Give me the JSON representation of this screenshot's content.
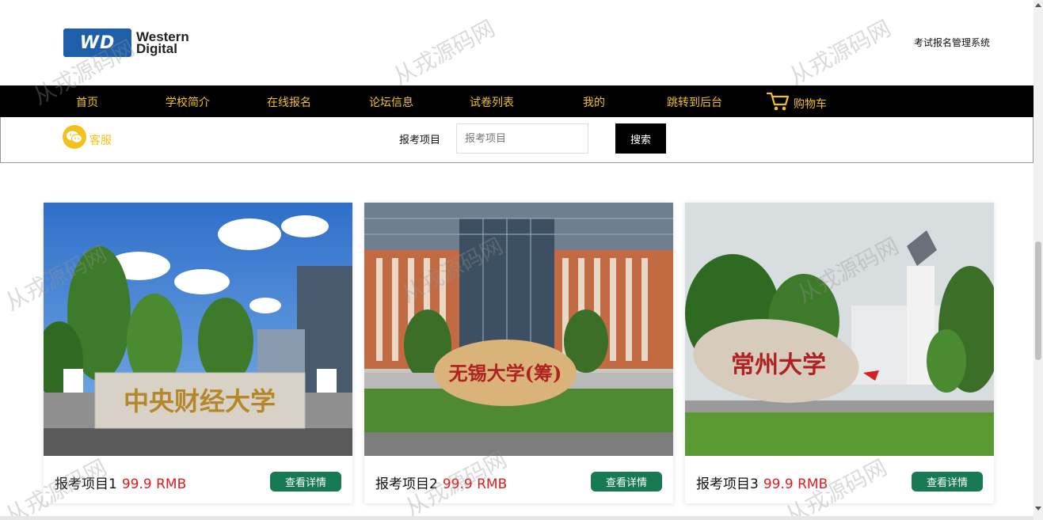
{
  "header": {
    "logo_text": [
      "Western",
      "Digital"
    ],
    "logo_mark": "WD",
    "system_title": "考试报名管理系统"
  },
  "nav": {
    "items": [
      {
        "label": "首页"
      },
      {
        "label": "学校简介"
      },
      {
        "label": "在线报名"
      },
      {
        "label": "论坛信息"
      },
      {
        "label": "试卷列表"
      },
      {
        "label": "我的"
      },
      {
        "label": "跳转到后台"
      }
    ],
    "cart_label": "购物车"
  },
  "service": {
    "label": "客服"
  },
  "search": {
    "label": "报考项目",
    "placeholder": "报考项目",
    "button": "搜索"
  },
  "cards": [
    {
      "name": "报考项目1",
      "price": "99.9 RMB",
      "button": "查看详情",
      "image": "central-university-of-finance-and-economics-gate"
    },
    {
      "name": "报考项目2",
      "price": "99.9 RMB",
      "button": "查看详情",
      "image": "wuxi-university-stone"
    },
    {
      "name": "报考项目3",
      "price": "99.9 RMB",
      "button": "查看详情",
      "image": "changzhou-university-stone"
    }
  ],
  "watermark": "从戎源码网",
  "colors": {
    "nav_bg": "#000000",
    "nav_text": "#f2c21b",
    "price": "#e21b1b",
    "detail_btn": "#177a52"
  }
}
